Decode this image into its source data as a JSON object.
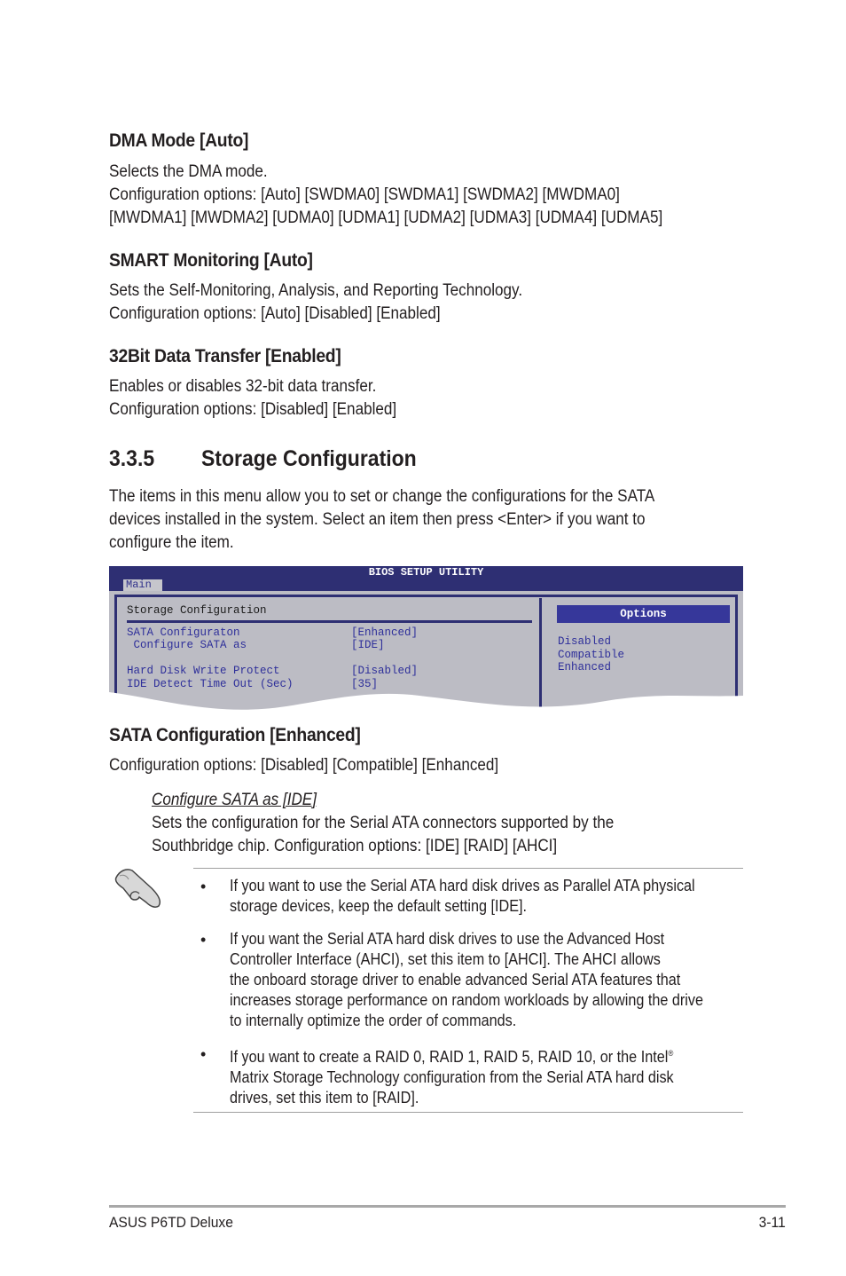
{
  "sections": {
    "dma_mode": {
      "heading": "DMA Mode [Auto]",
      "lines": [
        "Selects the DMA mode.",
        "Configuration options: [Auto] [SWDMA0] [SWDMA1] [SWDMA2] [MWDMA0]",
        "[MWDMA1] [MWDMA2] [UDMA0] [UDMA1] [UDMA2] [UDMA3] [UDMA4] [UDMA5]"
      ]
    },
    "smart_monitoring": {
      "heading": "SMART Monitoring [Auto]",
      "lines": [
        "Sets the Self-Monitoring, Analysis, and Reporting Technology.",
        "Configuration options: [Auto] [Disabled] [Enabled]"
      ]
    },
    "bit32_transfer": {
      "heading": "32Bit Data Transfer [Enabled]",
      "lines": [
        "Enables or disables 32-bit data transfer.",
        "Configuration options: [Disabled] [Enabled]"
      ]
    },
    "storage_config": {
      "number": "3.3.5",
      "title": "Storage Configuration",
      "lines": [
        "The items in this menu allow you to set or change the configurations for the SATA",
        "devices installed in the system. Select an item then press <Enter> if you want to",
        "configure the item."
      ]
    },
    "sata_config": {
      "heading": "SATA Configuration [Enhanced]",
      "lines": [
        "Configuration options: [Disabled] [Compatible] [Enhanced]"
      ],
      "sub_heading": "Configure SATA as [IDE]",
      "sub_lines": [
        "Sets the configuration for the Serial ATA connectors supported by the",
        "Southbridge chip. Configuration options: [IDE] [RAID] [AHCI]"
      ]
    }
  },
  "bios": {
    "title": "BIOS SETUP UTILITY",
    "tab": "Main",
    "panel_title": "Storage Configuration",
    "rows": [
      {
        "label": "SATA Configuraton",
        "value": "[Enhanced]"
      },
      {
        "label": " Configure SATA as",
        "value": "[IDE]"
      },
      {
        "label": "Hard Disk Write Protect",
        "value": "[Disabled]"
      },
      {
        "label": "IDE Detect Time Out (Sec)",
        "value": "[35]"
      }
    ],
    "options_header": "Options",
    "options": [
      "Disabled",
      "Compatible",
      "Enhanced"
    ],
    "colors": {
      "title_bar": "#2e2f73",
      "panel": "#bcbcc4",
      "text": "#2e2f9a",
      "options_header": "#36379a"
    }
  },
  "note": {
    "icon": "pointing-hand-icon",
    "bullet": "•",
    "items": [
      {
        "lines": [
          "If you want to use the Serial ATA hard disk drives as Parallel ATA physical",
          "storage devices, keep the default setting [IDE]."
        ]
      },
      {
        "lines": [
          "If you want the Serial ATA hard disk drives to use the Advanced Host",
          "Controller Interface (AHCI), set this item to [AHCI]. The AHCI allows",
          "the onboard storage driver to enable advanced Serial ATA features that",
          "increases storage performance on random workloads by allowing the drive",
          "to internally optimize the order of commands."
        ]
      },
      {
        "lines": [
          "If you want to create a RAID 0, RAID 1, RAID 5, RAID 10, or the Intel",
          "Matrix Storage Technology configuration from the Serial ATA hard disk",
          "drives, set this item to [RAID]."
        ],
        "registered_mark": "®"
      }
    ]
  },
  "footer": {
    "product": "ASUS P6TD Deluxe",
    "page": "3-11"
  }
}
